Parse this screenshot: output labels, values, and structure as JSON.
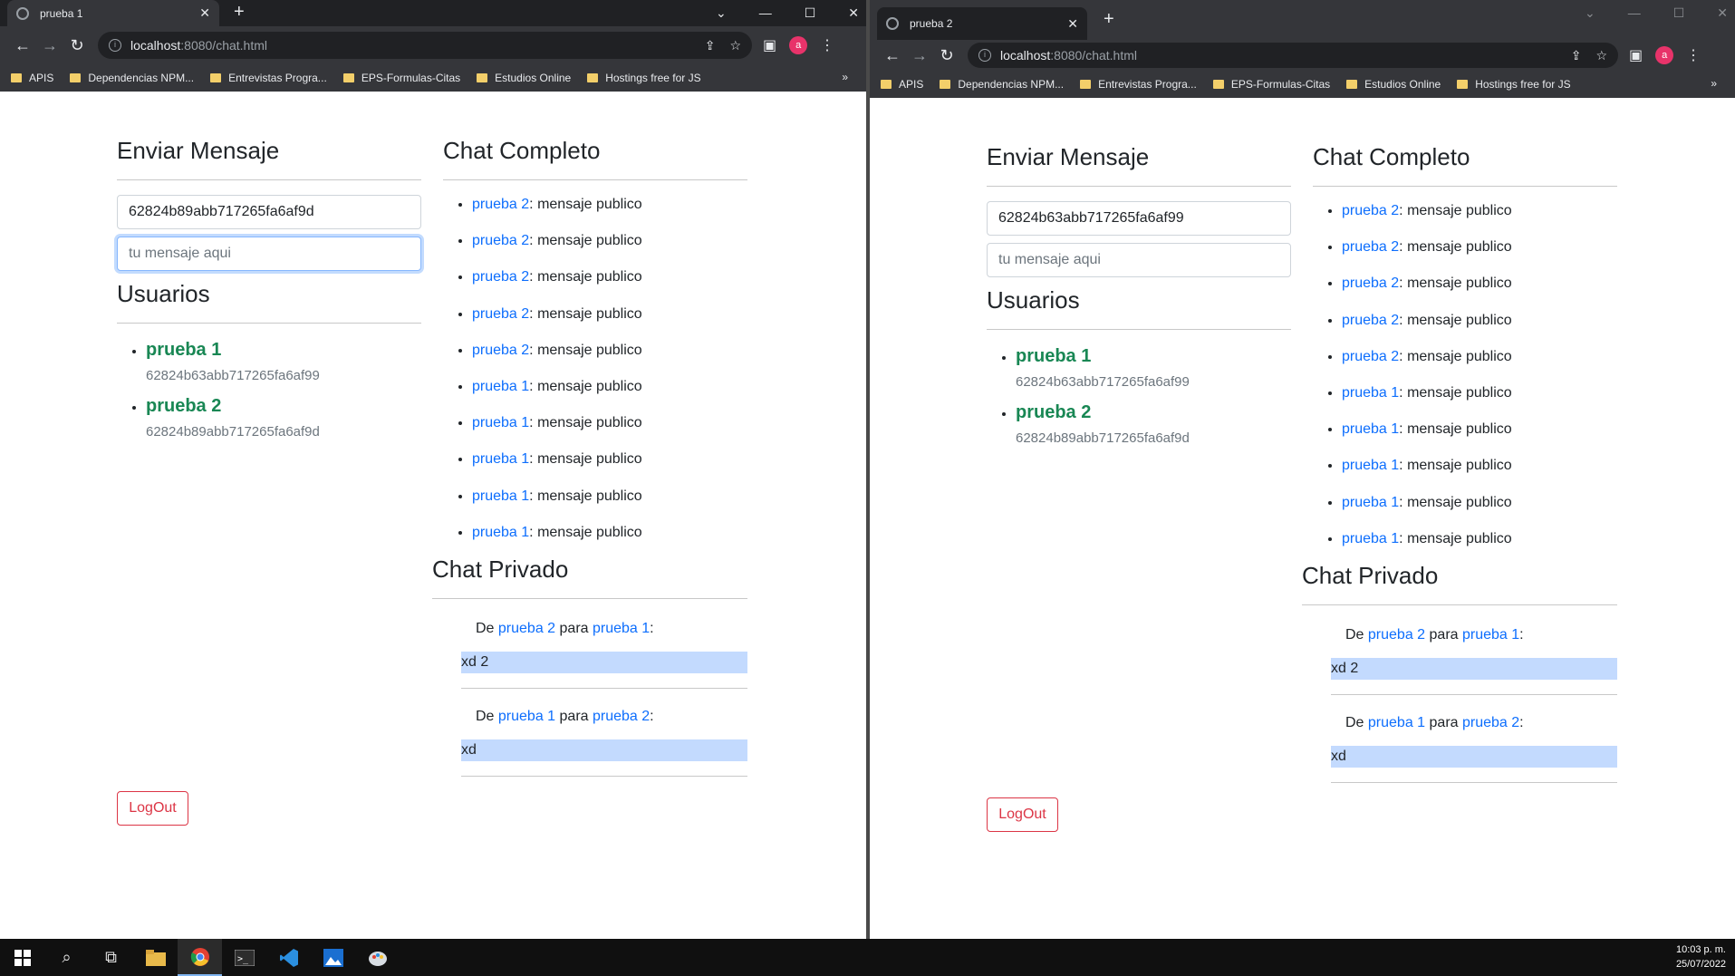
{
  "windows": [
    {
      "tab_title": "prueba 1",
      "url_host": "localhost",
      "url_path": ":8080/chat.html",
      "bookmarks": [
        "APIS",
        "Dependencias NPM...",
        "Entrevistas Progra...",
        "EPS-Formulas-Citas",
        "Estudios Online",
        "Hostings free for JS"
      ],
      "avatar_letter": "a",
      "enviar": {
        "title": "Enviar Mensaje",
        "id_value": "62824b89abb717265fa6af9d",
        "message_placeholder": "tu mensaje aqui"
      },
      "usuarios": {
        "title": "Usuarios",
        "items": [
          {
            "name": "prueba 1",
            "id": "62824b63abb717265fa6af99"
          },
          {
            "name": "prueba 2",
            "id": "62824b89abb717265fa6af9d"
          }
        ]
      },
      "chat": {
        "title": "Chat Completo",
        "items": [
          {
            "user": "prueba 2",
            "text": ": mensaje publico"
          },
          {
            "user": "prueba 2",
            "text": ": mensaje publico"
          },
          {
            "user": "prueba 2",
            "text": ": mensaje publico"
          },
          {
            "user": "prueba 2",
            "text": ": mensaje publico"
          },
          {
            "user": "prueba 2",
            "text": ": mensaje publico"
          },
          {
            "user": "prueba 1",
            "text": ": mensaje publico"
          },
          {
            "user": "prueba 1",
            "text": ": mensaje publico"
          },
          {
            "user": "prueba 1",
            "text": ": mensaje publico"
          },
          {
            "user": "prueba 1",
            "text": ": mensaje publico"
          },
          {
            "user": "prueba 1",
            "text": ": mensaje publico"
          }
        ]
      },
      "privado": {
        "title": "Chat Privado",
        "items": [
          {
            "de": "De ",
            "from": "prueba 2",
            "para": " para ",
            "to": "prueba 1",
            "colon": ":",
            "msg": "xd 2"
          },
          {
            "de": "De ",
            "from": "prueba 1",
            "para": " para ",
            "to": "prueba 2",
            "colon": ":",
            "msg": "xd"
          }
        ]
      },
      "logout_label": "LogOut"
    },
    {
      "tab_title": "prueba 2",
      "url_host": "localhost",
      "url_path": ":8080/chat.html",
      "bookmarks": [
        "APIS",
        "Dependencias NPM...",
        "Entrevistas Progra...",
        "EPS-Formulas-Citas",
        "Estudios Online",
        "Hostings free for JS"
      ],
      "avatar_letter": "a",
      "enviar": {
        "title": "Enviar Mensaje",
        "id_value": "62824b63abb717265fa6af99",
        "message_placeholder": "tu mensaje aqui"
      },
      "usuarios": {
        "title": "Usuarios",
        "items": [
          {
            "name": "prueba 1",
            "id": "62824b63abb717265fa6af99"
          },
          {
            "name": "prueba 2",
            "id": "62824b89abb717265fa6af9d"
          }
        ]
      },
      "chat": {
        "title": "Chat Completo",
        "items": [
          {
            "user": "prueba 2",
            "text": ": mensaje publico"
          },
          {
            "user": "prueba 2",
            "text": ": mensaje publico"
          },
          {
            "user": "prueba 2",
            "text": ": mensaje publico"
          },
          {
            "user": "prueba 2",
            "text": ": mensaje publico"
          },
          {
            "user": "prueba 2",
            "text": ": mensaje publico"
          },
          {
            "user": "prueba 1",
            "text": ": mensaje publico"
          },
          {
            "user": "prueba 1",
            "text": ": mensaje publico"
          },
          {
            "user": "prueba 1",
            "text": ": mensaje publico"
          },
          {
            "user": "prueba 1",
            "text": ": mensaje publico"
          },
          {
            "user": "prueba 1",
            "text": ": mensaje publico"
          }
        ]
      },
      "privado": {
        "title": "Chat Privado",
        "items": [
          {
            "de": "De ",
            "from": "prueba 2",
            "para": " para ",
            "to": "prueba 1",
            "colon": ":",
            "msg": "xd 2"
          },
          {
            "de": "De ",
            "from": "prueba 1",
            "para": " para ",
            "to": "prueba 2",
            "colon": ":",
            "msg": "xd"
          }
        ]
      },
      "logout_label": "LogOut"
    }
  ],
  "taskbar": {
    "icons": [
      "windows-start-icon",
      "search-icon",
      "task-view-icon",
      "file-explorer-icon",
      "chrome-icon",
      "terminal-icon",
      "vscode-icon",
      "photos-icon",
      "paint-icon"
    ],
    "time": "10:03 p. m.",
    "date": "25/07/2022"
  },
  "colors": {
    "link": "#0d6efd",
    "user_green": "#198754",
    "logout_red": "#dc3545",
    "private_msg_bg": "#c3dafe"
  }
}
